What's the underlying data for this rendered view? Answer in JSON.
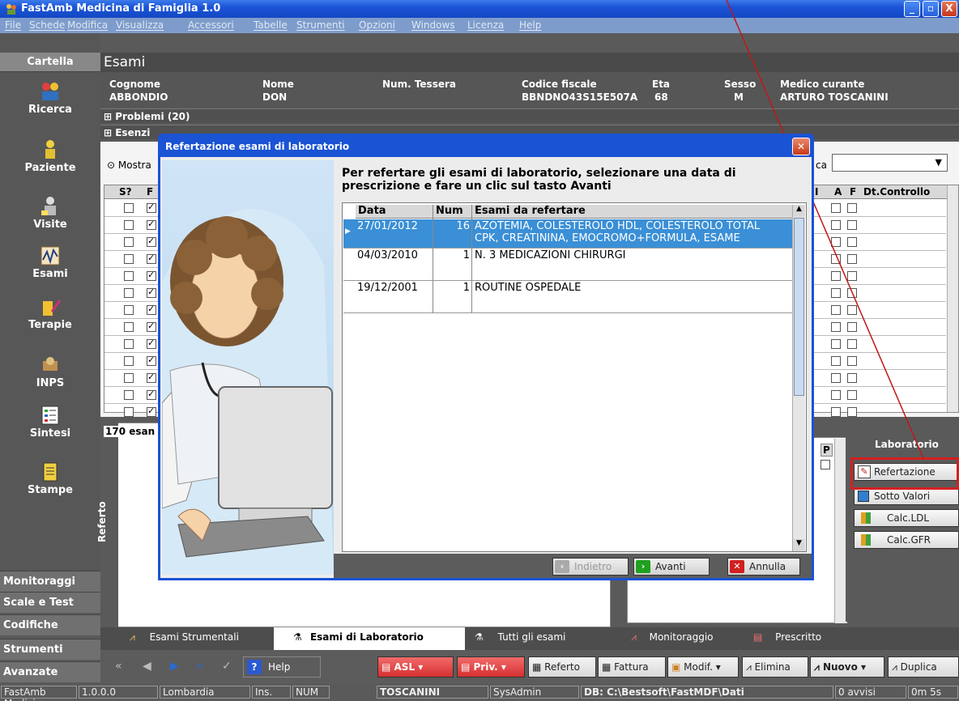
{
  "window": {
    "title": "FastAmb Medicina di Famiglia 1.0",
    "buttons": [
      "_",
      "▫",
      "X"
    ]
  },
  "menu": [
    "File",
    "Schede",
    "Modifica",
    "Visualizza",
    "Accessori",
    "Tabelle",
    "Strumenti",
    "Opzioni",
    "Windows",
    "Licenza",
    "Help"
  ],
  "sidebar": {
    "header": "Cartella",
    "items": [
      {
        "label": "Ricerca",
        "icon": "search-people-icon"
      },
      {
        "label": "Paziente",
        "icon": "patient-icon"
      },
      {
        "label": "Visite",
        "icon": "visit-icon"
      },
      {
        "label": "Esami",
        "icon": "chart-icon"
      },
      {
        "label": "Terapie",
        "icon": "pill-icon"
      },
      {
        "label": "INPS",
        "icon": "inps-icon"
      },
      {
        "label": "Sintesi",
        "icon": "summary-icon"
      },
      {
        "label": "Stampe",
        "icon": "print-icon"
      }
    ],
    "bottom": [
      "Monitoraggi",
      "Scale e Test",
      "Codifiche",
      "Strumenti",
      "Avanzate"
    ]
  },
  "main": {
    "title": "Esami",
    "patient": {
      "labels": [
        "Cognome",
        "Nome",
        "Num. Tessera",
        "Codice fiscale",
        "Eta",
        "Sesso",
        "Medico curante"
      ],
      "values": [
        "ABBONDIO",
        "DON",
        "",
        "BBNDNO43S15E507A",
        "68",
        "M",
        "ARTURO TOSCANINI"
      ]
    },
    "problems": "Problemi (20)",
    "esenzioni": "Esenzi",
    "mostra": "Mostra",
    "ca_label": "ca",
    "grid_left_headers": [
      "S?",
      "F"
    ],
    "grid_right_headers": [
      "I",
      "A",
      "F",
      "Dt.Controllo"
    ],
    "exam_count": "170 esan",
    "referto_label": "Referto",
    "p_label": "P"
  },
  "lab_panel": {
    "title": "Laboratorio",
    "buttons": [
      "Refertazione",
      "Sotto Valori",
      "Calc.LDL",
      "Calc.GFR"
    ]
  },
  "tabs": [
    "Esami Strumentali",
    "Esami di Laboratorio",
    "Tutti gli esami",
    "Monitoraggio",
    "Prescritto"
  ],
  "toolbar": {
    "help": "Help",
    "asl": "ASL",
    "priv": "Priv.",
    "referto": "Referto",
    "fattura": "Fattura",
    "modif": "Modif.",
    "elimina": "Elimina",
    "nuovo": "Nuovo",
    "duplica": "Duplica"
  },
  "status": [
    "FastAmb Medicir",
    "1.0.0.0",
    "Lombardia",
    "Ins.",
    "NUM",
    "TOSCANINI",
    "SysAdmin",
    "DB: C:\\Bestsoft\\FastMDF\\Dati",
    "0 avvisi",
    "0m 5s"
  ],
  "dialog": {
    "title": "Refertazione esami di laboratorio",
    "instruction": "Per refertare gli esami di laboratorio, selezionare una data di prescrizione e fare un clic sul tasto Avanti",
    "headers": [
      "Data",
      "Num",
      "Esami da refertare"
    ],
    "rows": [
      {
        "data": "27/01/2012",
        "num": "16",
        "esami1": "AZOTEMIA, COLESTEROLO HDL, COLESTEROLO TOTAL",
        "esami2": "CPK, CREATININA, EMOCROMO+FORMULA, ESAME",
        "selected": true
      },
      {
        "data": "04/03/2010",
        "num": "1",
        "esami1": "N. 3 MEDICAZIONI CHIRURGI",
        "esami2": "",
        "selected": false
      },
      {
        "data": "19/12/2001",
        "num": "1",
        "esami1": "ROUTINE OSPEDALE",
        "esami2": "",
        "selected": false
      }
    ],
    "buttons": {
      "back": "Indietro",
      "next": "Avanti",
      "cancel": "Annulla"
    }
  }
}
